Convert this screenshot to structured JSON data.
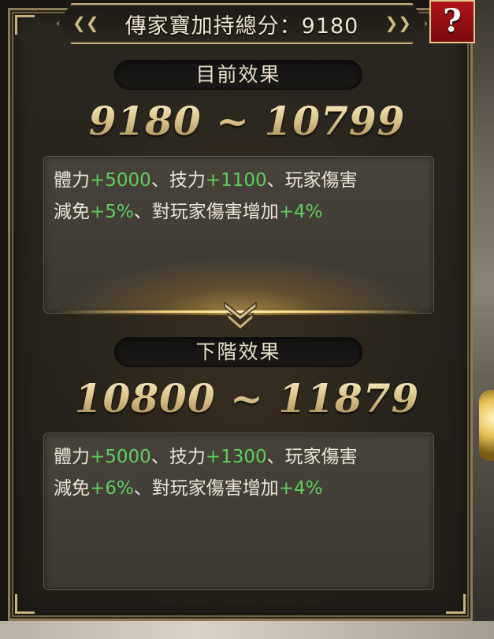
{
  "title": {
    "label": "傳家寶加持總分",
    "separator": "：",
    "score": "9180"
  },
  "help_button": {
    "label": "?"
  },
  "current": {
    "section_label": "目前效果",
    "range": "9180 ~ 10799",
    "line1": {
      "a": "體力",
      "a_val": "+5000",
      "b": "、技力",
      "b_val": "+1100",
      "c": "、玩家傷害"
    },
    "line2": {
      "a": "減免",
      "a_val": "+5%",
      "b": "、對玩家傷害增加",
      "b_val": "+4%"
    }
  },
  "next": {
    "section_label": "下階效果",
    "range": "10800 ~ 11879",
    "line1": {
      "a": "體力",
      "a_val": "+5000",
      "b": "、技力",
      "b_val": "+1300",
      "c": "、玩家傷害"
    },
    "line2": {
      "a": "減免",
      "a_val": "+6%",
      "b": "、對玩家傷害增加",
      "b_val": "+4%"
    }
  },
  "colors": {
    "bonus_value": "#5fcf5f",
    "help_button": "#a51218",
    "frame_gold": "#c8b57e"
  },
  "icons": {
    "divider": "double-chevron-down-icon"
  }
}
